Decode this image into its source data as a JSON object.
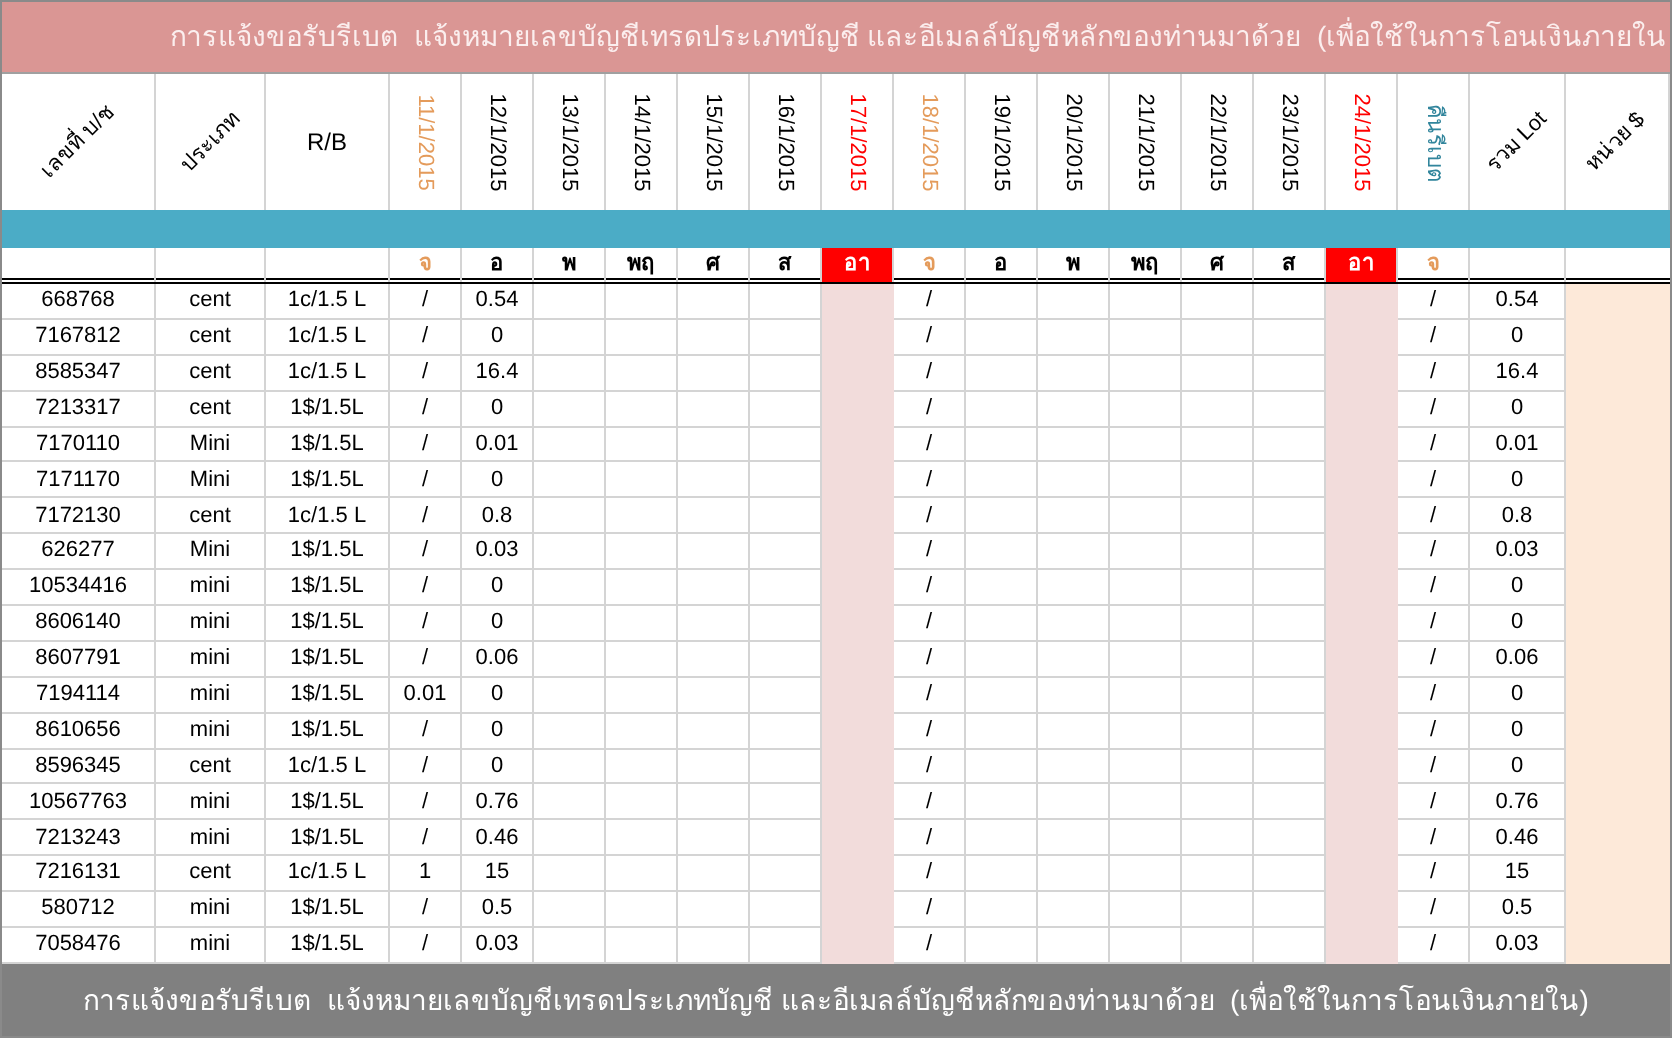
{
  "title": "การแจ้งขอรับรีเบต  แจ้งหมายเลขบัญชีเทรดประเภทบัญชี และอีเมลล์บัญชีหลักของท่านมาด้วย  (เพื่อใช้ในการโอนเงินภายใน",
  "columns": {
    "account": "เลขที่ บ/ช",
    "type": "ประเภท",
    "rb": "R/B",
    "total": "รวม Lot",
    "unit": "หน่วย $"
  },
  "dates": [
    {
      "label": "11/1/2015",
      "day": "จ",
      "color": "#e49b5b",
      "sunday": false
    },
    {
      "label": "12/1/2015",
      "day": "อ",
      "color": "#000000",
      "sunday": false
    },
    {
      "label": "13/1/2015",
      "day": "พ",
      "color": "#000000",
      "sunday": false
    },
    {
      "label": "14/1/2015",
      "day": "พฤ",
      "color": "#000000",
      "sunday": false
    },
    {
      "label": "15/1/2015",
      "day": "ศ",
      "color": "#000000",
      "sunday": false
    },
    {
      "label": "16/1/2015",
      "day": "ส",
      "color": "#000000",
      "sunday": false
    },
    {
      "label": "17/1/2015",
      "day": "อา",
      "color": "#ff0000",
      "sunday": true
    },
    {
      "label": "18/1/2015",
      "day": "จ",
      "color": "#e49b5b",
      "sunday": false
    },
    {
      "label": "19/1/2015",
      "day": "อ",
      "color": "#000000",
      "sunday": false
    },
    {
      "label": "20/1/2015",
      "day": "พ",
      "color": "#000000",
      "sunday": false
    },
    {
      "label": "21/1/2015",
      "day": "พฤ",
      "color": "#000000",
      "sunday": false
    },
    {
      "label": "22/1/2015",
      "day": "ศ",
      "color": "#000000",
      "sunday": false
    },
    {
      "label": "23/1/2015",
      "day": "ส",
      "color": "#000000",
      "sunday": false
    },
    {
      "label": "24/1/2015",
      "day": "อา",
      "color": "#ff0000",
      "sunday": true
    },
    {
      "label": "คืนรีเบต",
      "day": "จ",
      "color": "#31859c",
      "weekday": {
        "color": "#e49b5b"
      },
      "sunday": false
    }
  ],
  "rows": [
    {
      "account": "668768",
      "type": "cent",
      "rb": "1c/1.5 L",
      "jan_11": "/",
      "jan_12": "0.54",
      "jan_18": "/",
      "rebate": "/",
      "total": "0.54"
    },
    {
      "account": "7167812",
      "type": "cent",
      "rb": "1c/1.5 L",
      "jan_11": "/",
      "jan_12": "0",
      "jan_18": "/",
      "rebate": "/",
      "total": "0"
    },
    {
      "account": "8585347",
      "type": "cent",
      "rb": "1c/1.5 L",
      "jan_11": "/",
      "jan_12": "16.4",
      "jan_18": "/",
      "rebate": "/",
      "total": "16.4"
    },
    {
      "account": "7213317",
      "type": "cent",
      "rb": "1$/1.5L",
      "jan_11": "/",
      "jan_12": "0",
      "jan_18": "/",
      "rebate": "/",
      "total": "0"
    },
    {
      "account": "7170110",
      "type": "Mini",
      "rb": "1$/1.5L",
      "jan_11": "/",
      "jan_12": "0.01",
      "jan_18": "/",
      "rebate": "/",
      "total": "0.01"
    },
    {
      "account": "7171170",
      "type": "Mini",
      "rb": "1$/1.5L",
      "jan_11": "/",
      "jan_12": "0",
      "jan_18": "/",
      "rebate": "/",
      "total": "0"
    },
    {
      "account": "7172130",
      "type": "cent",
      "rb": "1c/1.5 L",
      "jan_11": "/",
      "jan_12": "0.8",
      "jan_18": "/",
      "rebate": "/",
      "total": "0.8"
    },
    {
      "account": "626277",
      "type": "Mini",
      "rb": "1$/1.5L",
      "jan_11": "/",
      "jan_12": "0.03",
      "jan_18": "/",
      "rebate": "/",
      "total": "0.03"
    },
    {
      "account": "10534416",
      "type": "mini",
      "rb": "1$/1.5L",
      "jan_11": "/",
      "jan_12": "0",
      "jan_18": "/",
      "rebate": "/",
      "total": "0"
    },
    {
      "account": "8606140",
      "type": "mini",
      "rb": "1$/1.5L",
      "jan_11": "/",
      "jan_12": "0",
      "jan_18": "/",
      "rebate": "/",
      "total": "0"
    },
    {
      "account": "8607791",
      "type": "mini",
      "rb": "1$/1.5L",
      "jan_11": "/",
      "jan_12": "0.06",
      "jan_18": "/",
      "rebate": "/",
      "total": "0.06"
    },
    {
      "account": "7194114",
      "type": "mini",
      "rb": "1$/1.5L",
      "jan_11": "0.01",
      "jan_12": "0",
      "jan_18": "/",
      "rebate": "/",
      "total": "0"
    },
    {
      "account": "8610656",
      "type": "mini",
      "rb": "1$/1.5L",
      "jan_11": "/",
      "jan_12": "0",
      "jan_18": "/",
      "rebate": "/",
      "total": "0"
    },
    {
      "account": "8596345",
      "type": "cent",
      "rb": "1c/1.5 L",
      "jan_11": "/",
      "jan_12": "0",
      "jan_18": "/",
      "rebate": "/",
      "total": "0"
    },
    {
      "account": "10567763",
      "type": "mini",
      "rb": "1$/1.5L",
      "jan_11": "/",
      "jan_12": "0.76",
      "jan_18": "/",
      "rebate": "/",
      "total": "0.76"
    },
    {
      "account": "7213243",
      "type": "mini",
      "rb": "1$/1.5L",
      "jan_11": "/",
      "jan_12": "0.46",
      "jan_18": "/",
      "rebate": "/",
      "total": "0.46"
    },
    {
      "account": "7216131",
      "type": "cent",
      "rb": "1c/1.5 L",
      "jan_11": "1",
      "jan_12": "15",
      "jan_18": "/",
      "rebate": "/",
      "total": "15"
    },
    {
      "account": "580712",
      "type": "mini",
      "rb": "1$/1.5L",
      "jan_11": "/",
      "jan_12": "0.5",
      "jan_18": "/",
      "rebate": "/",
      "total": "0.5"
    },
    {
      "account": "7058476",
      "type": "mini",
      "rb": "1$/1.5L",
      "jan_11": "/",
      "jan_12": "0.03",
      "jan_18": "/",
      "rebate": "/",
      "total": "0.03"
    }
  ],
  "footer": "การแจ้งขอรับรีเบต  แจ้งหมายเลขบัญชีเทรดประเภทบัญชี และอีเมลล์บัญชีหลักของท่านมาด้วย  (เพื่อใช้ในการโอนเงินภายใน)"
}
